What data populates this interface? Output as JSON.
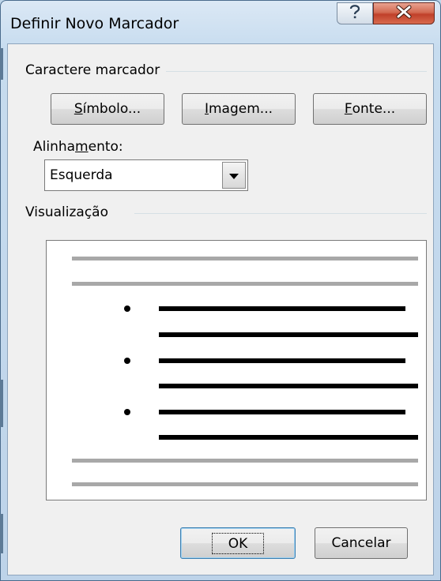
{
  "window": {
    "title": "Definir Novo Marcador",
    "help_icon": "question-mark-icon",
    "close_icon": "close-x-icon"
  },
  "caractere_group": {
    "label": "Caractere marcador",
    "symbol_button": {
      "mnemonic": "S",
      "rest": "ímbolo..."
    },
    "image_button": {
      "mnemonic": "I",
      "rest": "magem..."
    },
    "font_button": {
      "mnemonic": "F",
      "rest": "onte..."
    }
  },
  "alignment": {
    "label_pre": "Alinha",
    "label_mnemonic": "m",
    "label_post": "ento:",
    "value": "Esquerda",
    "arrow_icon": "dropdown-arrow-icon"
  },
  "preview_group": {
    "label": "Visualização"
  },
  "footer": {
    "ok_label": "OK",
    "cancel_label": "Cancelar"
  },
  "colors": {
    "title_bar": "#c7dcef",
    "close_button": "#c0402a",
    "dialog_background": "#f0f0f0",
    "preview_gray_line": "#a8a8a8",
    "preview_black_line": "#000000"
  }
}
